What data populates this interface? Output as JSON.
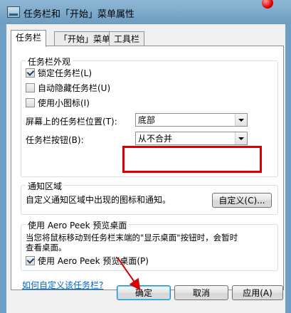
{
  "window": {
    "title": "任务栏和「开始」菜单属性"
  },
  "tabs": [
    {
      "label": "任务栏"
    },
    {
      "label": "「开始」菜单"
    },
    {
      "label": "工具栏"
    }
  ],
  "appearance": {
    "title": "任务栏外观",
    "lock_taskbar": {
      "label": "锁定任务栏(L)",
      "checked": true
    },
    "autohide": {
      "label": "自动隐藏任务栏(U)",
      "checked": false
    },
    "small_icons": {
      "label": "使用小图标(I)",
      "checked": false
    },
    "location_label": "屏幕上的任务栏位置(T):",
    "location_value": "底部",
    "buttons_label": "任务栏按钮(B):",
    "buttons_value": "从不合并"
  },
  "notification": {
    "title": "通知区域",
    "text": "自定义通知区域中出现的图标和通知。",
    "customize_button": "自定义(C)..."
  },
  "peek": {
    "title": "使用 Aero Peek 预览桌面",
    "desc1": "当您将鼠标移动到任务栏末端的\"显示桌面\"按钮时，会暂时",
    "desc2": "查看桌面。",
    "checkbox": {
      "label": "使用 Aero Peek 预览桌面(P)",
      "checked": true
    }
  },
  "help_link": "如何自定义该任务栏?",
  "footer": {
    "ok": "确定",
    "cancel": "取消",
    "apply": "应用(A)"
  }
}
